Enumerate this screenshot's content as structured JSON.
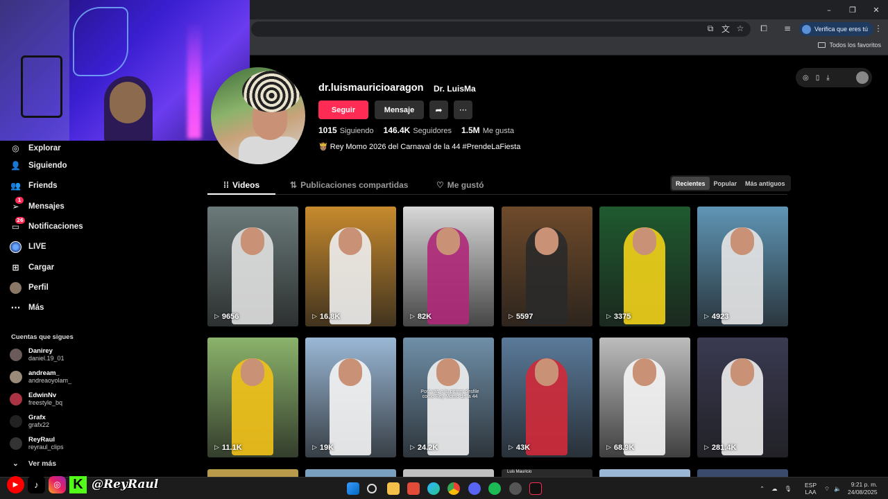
{
  "browser": {
    "verify_label": "Verifica que eres tú",
    "bookmarks_all": "Todos los favoritos",
    "window_controls": [
      "–",
      "❐",
      "✕"
    ]
  },
  "sidebar": {
    "items": [
      {
        "label": "Explorar",
        "icon": "compass-icon"
      },
      {
        "label": "Siguiendo",
        "icon": "person-icon"
      },
      {
        "label": "Friends",
        "icon": "friends-icon"
      },
      {
        "label": "Mensajes",
        "icon": "send-icon",
        "badge": "1"
      },
      {
        "label": "Notificaciones",
        "icon": "inbox-icon",
        "badge": "26"
      },
      {
        "label": "LIVE",
        "icon": "live-icon"
      },
      {
        "label": "Cargar",
        "icon": "plus-icon"
      },
      {
        "label": "Perfil",
        "icon": "avatar-icon"
      },
      {
        "label": "Más",
        "icon": "more-icon"
      }
    ],
    "following_title": "Cuentas que sigues",
    "following": [
      {
        "name": "Danirey",
        "handle": "daniel.19_01"
      },
      {
        "name": "andream_",
        "handle": "andreaoyolam_"
      },
      {
        "name": "EdwinNv",
        "handle": "freestyle_bq"
      },
      {
        "name": "Grafx",
        "handle": "grafx22"
      },
      {
        "name": "ReyRaul",
        "handle": "reyraul_clips"
      }
    ],
    "see_more": "Ver más"
  },
  "overlay": {
    "social_handle": "@ReyRaul"
  },
  "profile": {
    "username": "dr.luismauricioaragon",
    "nickname": "Dr. LuisMa",
    "follow_label": "Seguir",
    "message_label": "Mensaje",
    "following_count": "1015",
    "following_label": "Siguiendo",
    "followers_count": "146.4K",
    "followers_label": "Seguidores",
    "likes_count": "1.5M",
    "likes_label": "Me gusta",
    "bio": "🤴🏽 Rey Momo 2026 del Carnaval de la 44 #PrendeLaFiesta"
  },
  "tabs": {
    "videos": "Videos",
    "reposts": "Publicaciones compartidas",
    "liked": "Me gustó"
  },
  "sort": [
    "Recientes",
    "Popular",
    "Más antiguos"
  ],
  "videos": [
    {
      "views": "9656",
      "bg": "#6b7a7a",
      "fig": "#e0e0e0"
    },
    {
      "views": "16.8K",
      "bg": "#c78a2e",
      "fig": "#eeeeee"
    },
    {
      "views": "82K",
      "bg": "#d8d8d8",
      "fig": "#b0287a"
    },
    {
      "views": "5597",
      "bg": "#6e4a2a",
      "fig": "#2a2a2a"
    },
    {
      "views": "3375",
      "bg": "#1f5a2f",
      "fig": "#f2d21a"
    },
    {
      "views": "4923",
      "bg": "#5f95b5",
      "fig": "#e6e6e6"
    },
    {
      "views": "11.1K",
      "bg": "#8bb36b",
      "fig": "#f2c21a"
    },
    {
      "views": "19K",
      "bg": "#9ab8d6",
      "fig": "#f4f4f4"
    },
    {
      "views": "24.2K",
      "bg": "#6f8fa8",
      "fig": "#f0f0f0",
      "caption": "Post vas a tu primer desfile como Rey Momo de la 44"
    },
    {
      "views": "43K",
      "bg": "#5a7a9a",
      "fig": "#d22a3a"
    },
    {
      "views": "68.9K",
      "bg": "#bdbdbd",
      "fig": "#f5f5f5"
    },
    {
      "views": "281.4K",
      "bg": "#3a3a52",
      "fig": "#eeeeee"
    }
  ],
  "next_row_label": "Luis Mauricio",
  "taskbar": {
    "lang_top": "ESP",
    "lang_bottom": "LAA",
    "time": "9:21 p. m.",
    "date": "24/08/2025"
  }
}
